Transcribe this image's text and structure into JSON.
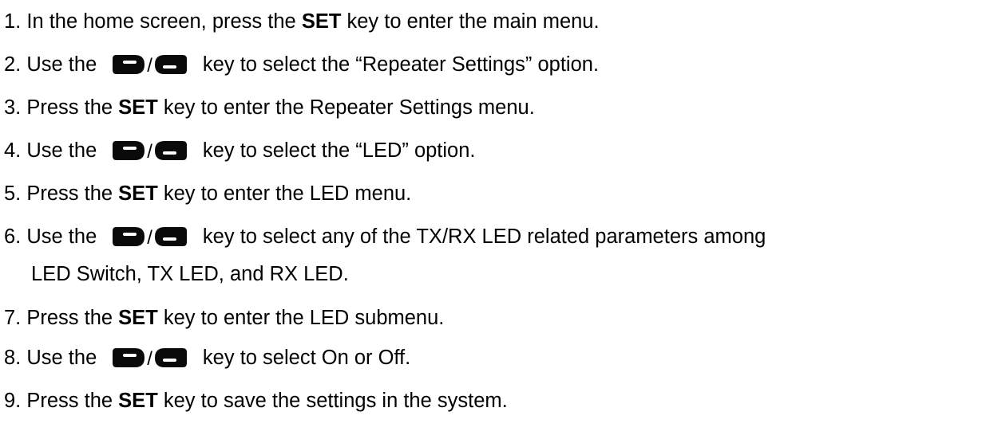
{
  "steps": [
    {
      "num": "1.",
      "parts": [
        {
          "t": "text",
          "v": " In the home screen, press the "
        },
        {
          "t": "bold",
          "v": "SET"
        },
        {
          "t": "text",
          "v": " key to enter the main menu."
        }
      ]
    },
    {
      "num": "2.",
      "parts": [
        {
          "t": "text",
          "v": " Use the"
        },
        {
          "t": "keys"
        },
        {
          "t": "text",
          "v": "key to select the “Repeater Settings” option."
        }
      ]
    },
    {
      "num": "3.",
      "parts": [
        {
          "t": "text",
          "v": " Press the "
        },
        {
          "t": "bold",
          "v": "SET"
        },
        {
          "t": "text",
          "v": " key to enter the Repeater Settings menu."
        }
      ]
    },
    {
      "num": "4.",
      "parts": [
        {
          "t": "text",
          "v": " Use the"
        },
        {
          "t": "keys"
        },
        {
          "t": "text",
          "v": "key to select the “LED” option."
        }
      ]
    },
    {
      "num": "5.",
      "parts": [
        {
          "t": "text",
          "v": " Press the "
        },
        {
          "t": "bold",
          "v": "SET"
        },
        {
          "t": "text",
          "v": " key to enter the LED menu."
        }
      ]
    },
    {
      "num": "6.",
      "parts": [
        {
          "t": "text",
          "v": " Use the"
        },
        {
          "t": "keys"
        },
        {
          "t": "text",
          "v": "key to select any of the TX/RX LED related parameters among"
        }
      ],
      "continuation": "LED Switch, TX LED, and RX LED."
    },
    {
      "num": "7.",
      "parts": [
        {
          "t": "text",
          "v": " Press the "
        },
        {
          "t": "bold",
          "v": "SET"
        },
        {
          "t": "text",
          "v": " key to enter the LED submenu."
        }
      ]
    },
    {
      "num": "8.",
      "parts": [
        {
          "t": "text",
          "v": " Use the"
        },
        {
          "t": "keys"
        },
        {
          "t": "text",
          "v": "key to select On or Off."
        }
      ]
    },
    {
      "num": "9.",
      "parts": [
        {
          "t": "text",
          "v": " Press the "
        },
        {
          "t": "bold",
          "v": "SET"
        },
        {
          "t": "text",
          "v": " key to save the settings in the system."
        }
      ]
    }
  ],
  "icons": {
    "up_key": "up-key-icon",
    "down_key": "down-key-icon",
    "separator": "/"
  },
  "colors": {
    "text": "#000000",
    "key_fill": "#0a0a0a",
    "key_mark": "#ffffff"
  }
}
